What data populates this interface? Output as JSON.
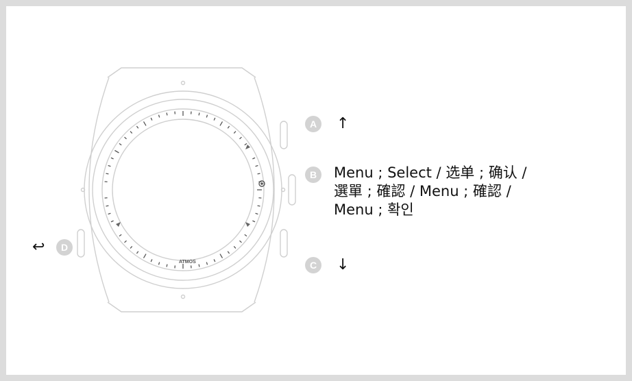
{
  "brand": "ATMOS",
  "buttons": {
    "a": {
      "badge": "A",
      "arrow": "↑"
    },
    "b": {
      "badge": "B",
      "text": "Menu ; Select / 选单 ; 确认 /\n選單 ; 確認 / Menu ; 確認 /\nMenu ; 확인"
    },
    "c": {
      "badge": "C",
      "arrow": "↓"
    },
    "d": {
      "badge": "D",
      "arrow": "↩"
    }
  }
}
